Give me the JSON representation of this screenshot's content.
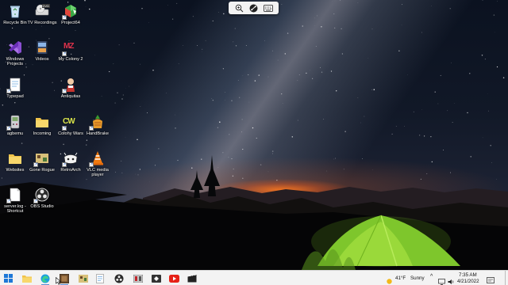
{
  "desktop": {
    "icons": [
      {
        "id": "recycle-bin",
        "label": "Recycle Bin",
        "icon": "recycle-bin-icon"
      },
      {
        "id": "tv-recordings",
        "label": "TV Recordings",
        "icon": "dvd-drive-icon",
        "badge": "DVD"
      },
      {
        "id": "project64",
        "label": "Project64",
        "icon": "project64-icon"
      },
      {
        "id": "windows-projects",
        "label": "Windows Projects",
        "icon": "visual-studio-icon"
      },
      {
        "id": "videos",
        "label": "Videos",
        "icon": "film-folder-icon"
      },
      {
        "id": "my-colony-2",
        "label": "My Colony 2",
        "icon": "my-colony-icon",
        "badge": "MZ"
      },
      {
        "id": "typepad",
        "label": "Typepad",
        "icon": "notepad-icon"
      },
      {
        "id": "antiquitas",
        "label": "Antiquitas",
        "icon": "character-icon"
      },
      {
        "id": "agbemu",
        "label": "agbemu",
        "icon": "gameboy-icon"
      },
      {
        "id": "incoming",
        "label": "Incoming",
        "icon": "folder-icon"
      },
      {
        "id": "colony-wars",
        "label": "Colony Wars",
        "icon": "colony-wars-icon",
        "badge": "CW"
      },
      {
        "id": "handbrake",
        "label": "HandBrake",
        "icon": "handbrake-icon"
      },
      {
        "id": "websites",
        "label": "Websites",
        "icon": "folder-icon"
      },
      {
        "id": "gone-rogue",
        "label": "Gone Rogue",
        "icon": "gone-rogue-icon"
      },
      {
        "id": "retroarch",
        "label": "RetroArch",
        "icon": "retroarch-icon"
      },
      {
        "id": "vlc",
        "label": "VLC media player",
        "icon": "vlc-cone-icon"
      },
      {
        "id": "server-log",
        "label": "server.log - Shortcut",
        "icon": "document-icon"
      },
      {
        "id": "obs-studio",
        "label": "OBS Studio",
        "icon": "obs-icon"
      }
    ]
  },
  "remote_toolbar": {
    "buttons": [
      "zoom-icon",
      "remote-connection-icon",
      "keyboard-icon"
    ]
  },
  "taskbar": {
    "apps": [
      {
        "name": "start-button",
        "icon": "windows-logo-icon"
      },
      {
        "name": "taskbar-file-explorer",
        "icon": "folder-icon"
      },
      {
        "name": "taskbar-edge",
        "icon": "edge-icon"
      },
      {
        "name": "taskbar-app-brown",
        "icon": "app-tile-icon"
      },
      {
        "name": "taskbar-gone-rogue",
        "icon": "gone-rogue-icon"
      },
      {
        "name": "taskbar-notepad",
        "icon": "notepad-icon"
      },
      {
        "name": "taskbar-obs",
        "icon": "obs-icon"
      },
      {
        "name": "taskbar-media-app",
        "icon": "media-app-icon"
      },
      {
        "name": "taskbar-remote-app",
        "icon": "remote-app-icon"
      },
      {
        "name": "taskbar-youtube",
        "icon": "youtube-icon"
      },
      {
        "name": "taskbar-retroarch",
        "icon": "retroarch-icon"
      },
      {
        "name": "taskbar-clapper",
        "icon": "clapperboard-icon"
      }
    ],
    "weather": {
      "temp": "41°F",
      "condition": "Sunny"
    },
    "clock": {
      "time": "7:35 AM",
      "date": "4/21/2022"
    },
    "colors": {
      "accent": "#5a8fd8",
      "bar": "#f3f3f3"
    }
  }
}
